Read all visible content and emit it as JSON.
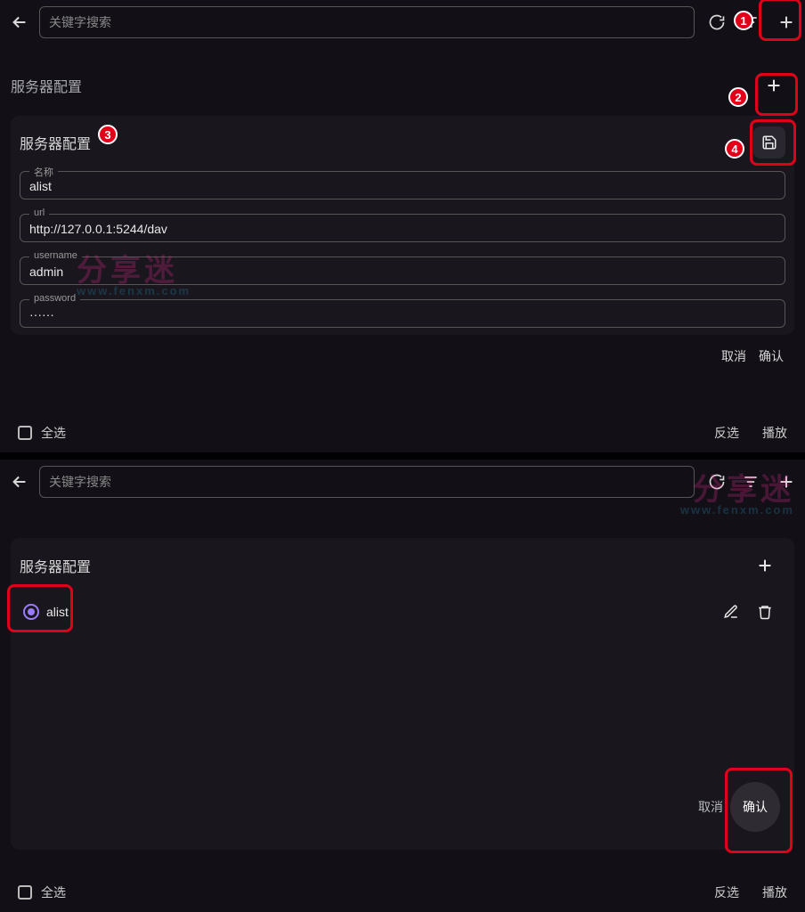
{
  "watermark": {
    "line1": "分享迷",
    "line2": "www.fenxm.com"
  },
  "panel1": {
    "search_placeholder": "关键字搜索",
    "section_title_outer": "服务器配置",
    "section_title_inner": "服务器配置",
    "fields": {
      "name": {
        "label": "名称",
        "value": "alist"
      },
      "url": {
        "label": "url",
        "value": "http://127.0.0.1:5244/dav"
      },
      "username": {
        "label": "username",
        "value": "admin"
      },
      "password": {
        "label": "password",
        "value": "······"
      }
    },
    "buttons": {
      "cancel": "取消",
      "confirm": "确认"
    },
    "bottom": {
      "select_all": "全选",
      "invert": "反选",
      "play": "播放"
    },
    "callouts": [
      "1",
      "2",
      "3",
      "4"
    ]
  },
  "panel2": {
    "search_placeholder": "关键字搜索",
    "section_title": "服务器配置",
    "item_label": "alist",
    "buttons": {
      "cancel": "取消",
      "confirm": "确认"
    },
    "bottom": {
      "select_all": "全选",
      "invert": "反选",
      "play": "播放"
    }
  }
}
